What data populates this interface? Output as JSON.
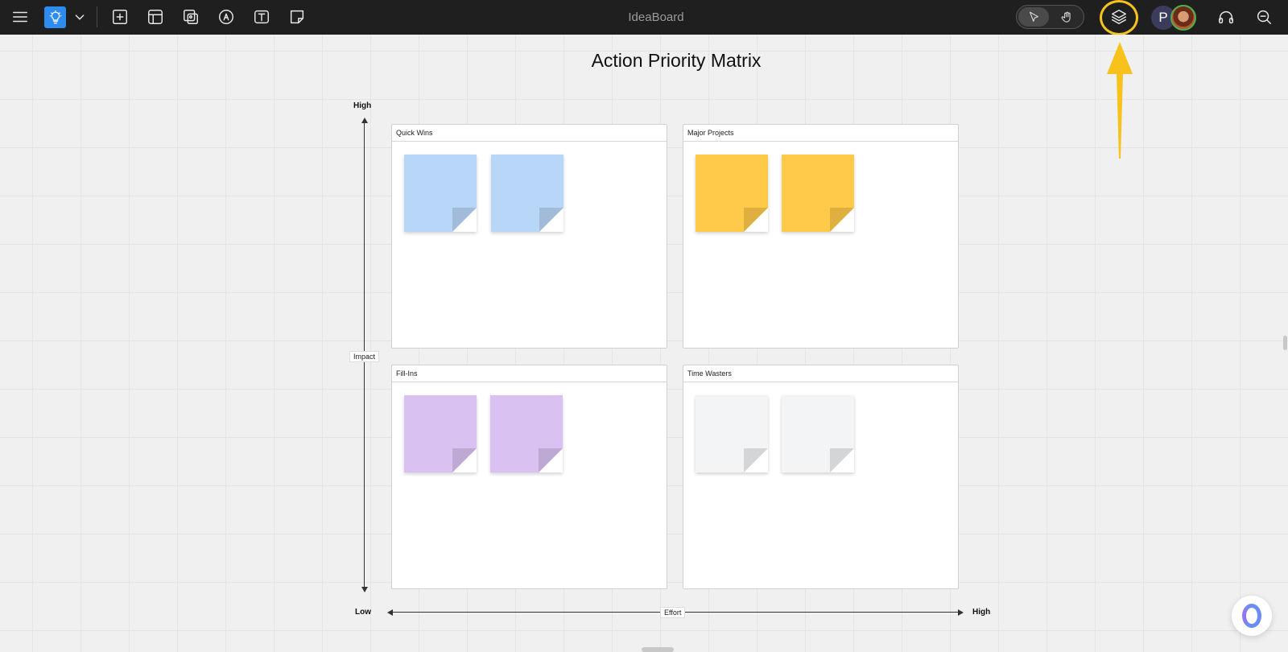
{
  "app": {
    "title": "IdeaBoard"
  },
  "toolbar": {
    "icons": [
      "menu-icon",
      "lightbulb-icon",
      "chevron-down-icon",
      "add-icon",
      "template-icon",
      "media-icon",
      "pen-icon",
      "text-icon",
      "sticky-note-icon"
    ]
  },
  "right_toolbar": {
    "user_initial": "P",
    "icons": [
      "select-cursor-icon",
      "hand-pan-icon",
      "layers-icon",
      "headphones-icon",
      "zoom-out-icon"
    ],
    "highlight_color": "#f7c21b"
  },
  "board": {
    "title": "Action Priority Matrix",
    "y_axis": {
      "label": "Impact",
      "high": "High"
    },
    "x_axis": {
      "label": "Effort",
      "low": "Low",
      "high": "High"
    },
    "quadrants": [
      {
        "name": "Quick Wins",
        "sticky_color": "#b8d6f7"
      },
      {
        "name": "Major Projects",
        "sticky_color": "#ffc94a"
      },
      {
        "name": "Fill-Ins",
        "sticky_color": "#d9c2f2"
      },
      {
        "name": "Time Wasters",
        "sticky_color": "#f3f4f6"
      }
    ]
  }
}
